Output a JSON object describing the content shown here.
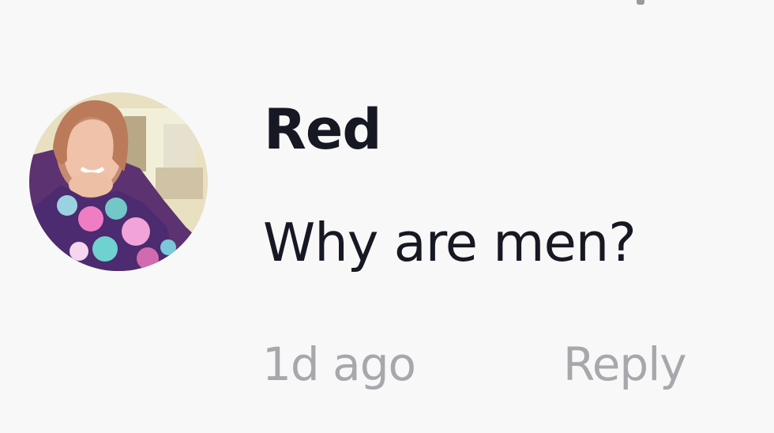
{
  "comment": {
    "username": "Red",
    "text": "Why are men?",
    "timestamp": "1d ago",
    "reply_label": "Reply",
    "avatar_icon": "profile-photo-icon"
  },
  "colors": {
    "background": "#f8f8f8",
    "primary_text": "#161823",
    "secondary_text": "#a7a8ac"
  }
}
